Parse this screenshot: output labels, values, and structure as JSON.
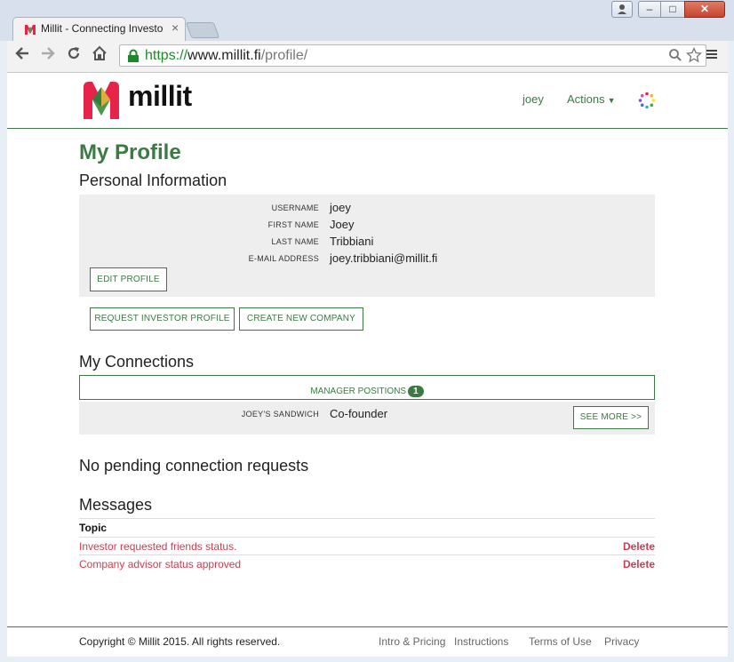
{
  "browser": {
    "tab_title": "Millit - Connecting Investo",
    "tab_close": "×",
    "url_protocol": "https://",
    "url_host": "www.millit.fi",
    "url_path": "/profile/",
    "window_controls": {
      "minimize": "–",
      "maximize": "□",
      "close": "✕"
    }
  },
  "header": {
    "logo_text": "millit",
    "user": "joey",
    "actions": "Actions"
  },
  "profile": {
    "title": "My Profile",
    "personal_heading": "Personal Information",
    "fields": [
      {
        "label": "USERNAME",
        "value": "joey"
      },
      {
        "label": "FIRST NAME",
        "value": "Joey"
      },
      {
        "label": "LAST NAME",
        "value": "Tribbiani"
      },
      {
        "label": "E-MAIL ADDRESS",
        "value": "joey.tribbiani@millit.fi"
      }
    ],
    "edit_button": "EDIT PROFILE",
    "request_investor_button": "REQUEST INVESTOR PROFILE",
    "create_company_button": "CREATE NEW COMPANY"
  },
  "connections": {
    "heading": "My Connections",
    "manager_label": "MANAGER POSITIONS",
    "manager_count": "1",
    "company": "JOEY'S SANDWICH",
    "role": "Co-founder",
    "see_more": "SEE MORE >>",
    "pending": "No pending connection requests"
  },
  "messages": {
    "heading": "Messages",
    "topic_header": "Topic",
    "items": [
      {
        "text": "Investor requested friends status.",
        "action": "Delete"
      },
      {
        "text": "Company advisor status approved",
        "action": "Delete"
      }
    ]
  },
  "footer": {
    "copyright": "Copyright © Millit 2015. All rights reserved.",
    "links": [
      "Intro & Pricing",
      "Instructions",
      "Terms of Use",
      "Privacy"
    ]
  },
  "colors": {
    "brand_green": "#3b7a43",
    "alert_red": "#d43a4f",
    "panel_gray": "#eeeeee"
  }
}
